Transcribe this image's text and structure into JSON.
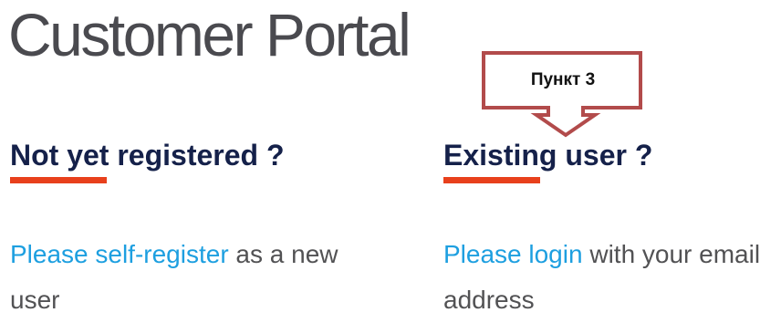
{
  "page": {
    "title": "Customer Portal"
  },
  "left_column": {
    "heading": "Not yet registered ?",
    "link_text": "Please self-register",
    "rest_text": " as a new user"
  },
  "right_column": {
    "heading": "Existing user ?",
    "link_text": "Please login",
    "rest_text": " with your email address"
  },
  "annotation": {
    "label": "Пункт 3",
    "color": "#b24b4b"
  },
  "colors": {
    "title": "#4a4a4f",
    "heading": "#15214a",
    "accent_underline": "#e8401c",
    "link": "#1d9fe0",
    "body_text": "#525254"
  }
}
